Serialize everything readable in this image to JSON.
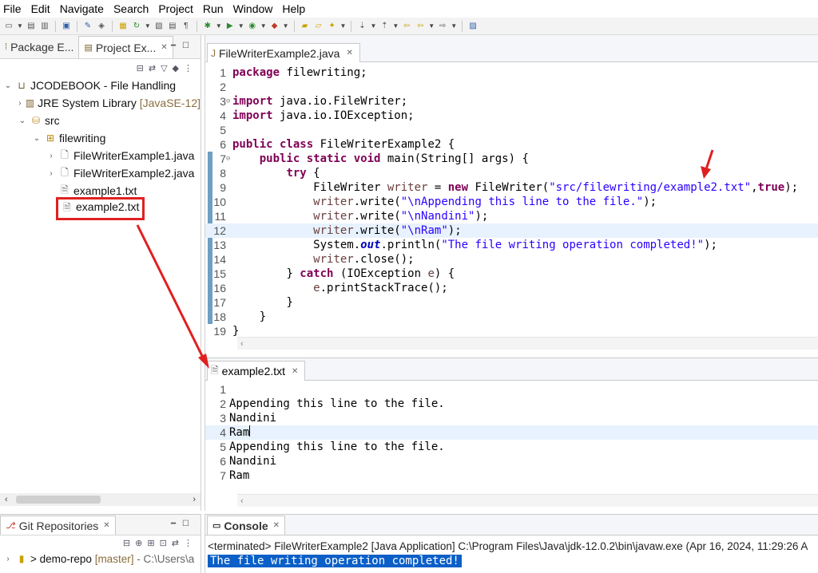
{
  "menu": [
    "File",
    "Edit",
    "Navigate",
    "Search",
    "Project",
    "Run",
    "Window",
    "Help"
  ],
  "left_tabs": {
    "package": "Package E...",
    "project": "Project Ex..."
  },
  "tree": {
    "project": "JCODEBOOK - File Handling",
    "jre": "JRE System Library",
    "jre_tag": "[JavaSE-12]",
    "src": "src",
    "package": "filewriting",
    "file1": "FileWriterExample1.java",
    "file2": "FileWriterExample2.java",
    "txt1": "example1.txt",
    "txt2": "example2.txt"
  },
  "editor": {
    "tab": "FileWriterExample2.java",
    "lines": [
      "1",
      "2",
      "3",
      "4",
      "5",
      "6",
      "7",
      "8",
      "9",
      "10",
      "11",
      "12",
      "13",
      "14",
      "15",
      "16",
      "17",
      "18",
      "19"
    ]
  },
  "code": {
    "l1a": "package",
    "l1b": " filewriting;",
    "l3a": "import",
    "l3b": " java.io.FileWriter;",
    "l4a": "import",
    "l4b": " java.io.IOException;",
    "l6a": "public class",
    "l6b": " FileWriterExample2 {",
    "l7a": "public static void",
    "l7b": " main(String[] args) {",
    "l8": "try",
    "l9a": "FileWriter ",
    "l9b": "writer",
    "l9c": " = ",
    "l9d": "new",
    "l9e": " FileWriter(",
    "l9f": "\"src/filewriting/example2.txt\"",
    "l9g": ",",
    "l9h": "true",
    "l9i": ");",
    "l10a": "writer",
    "l10b": ".write(",
    "l10c": "\"\\nAppending this line to the file.\"",
    "l10d": ");",
    "l11a": "writer",
    "l11b": ".write(",
    "l11c": "\"\\nNandini\"",
    "l11d": ");",
    "l12a": "writer",
    "l12b": ".write(",
    "l12c": "\"\\nRam\"",
    "l12d": ");",
    "l13a": "System.",
    "l13b": "out",
    "l13c": ".println(",
    "l13d": "\"The file writing operation completed!\"",
    "l13e": ");",
    "l14a": "writer",
    "l14b": ".close();",
    "l15a": "} ",
    "l15b": "catch",
    "l15c": " (IOException ",
    "l15d": "e",
    "l15e": ") {",
    "l16a": "e",
    "l16b": ".printStackTrace();",
    "l17": "}",
    "l18": "}",
    "l19": "}"
  },
  "editor2": {
    "tab": "example2.txt",
    "lines": [
      "1",
      "2",
      "3",
      "4",
      "5",
      "6",
      "7"
    ],
    "text": [
      "",
      "Appending this line to the file.",
      "Nandini",
      "Ram",
      "Appending this line to the file.",
      "Nandini",
      "Ram"
    ]
  },
  "git": {
    "tab": "Git Repositories",
    "repo": "> demo-repo",
    "branch": "[master]",
    "path": "- C:\\Users\\a"
  },
  "console": {
    "tab": "Console",
    "terminated": "<terminated> FileWriterExample2 [Java Application] C:\\Program Files\\Java\\jdk-12.0.2\\bin\\javaw.exe  (Apr 16, 2024, 11:29:26 A",
    "output": "The file writing operation completed!"
  },
  "colors": {
    "keyword": "#7f0055",
    "string": "#2a00ff",
    "annotation": "#e02020",
    "selection": "#0b5fc7"
  }
}
